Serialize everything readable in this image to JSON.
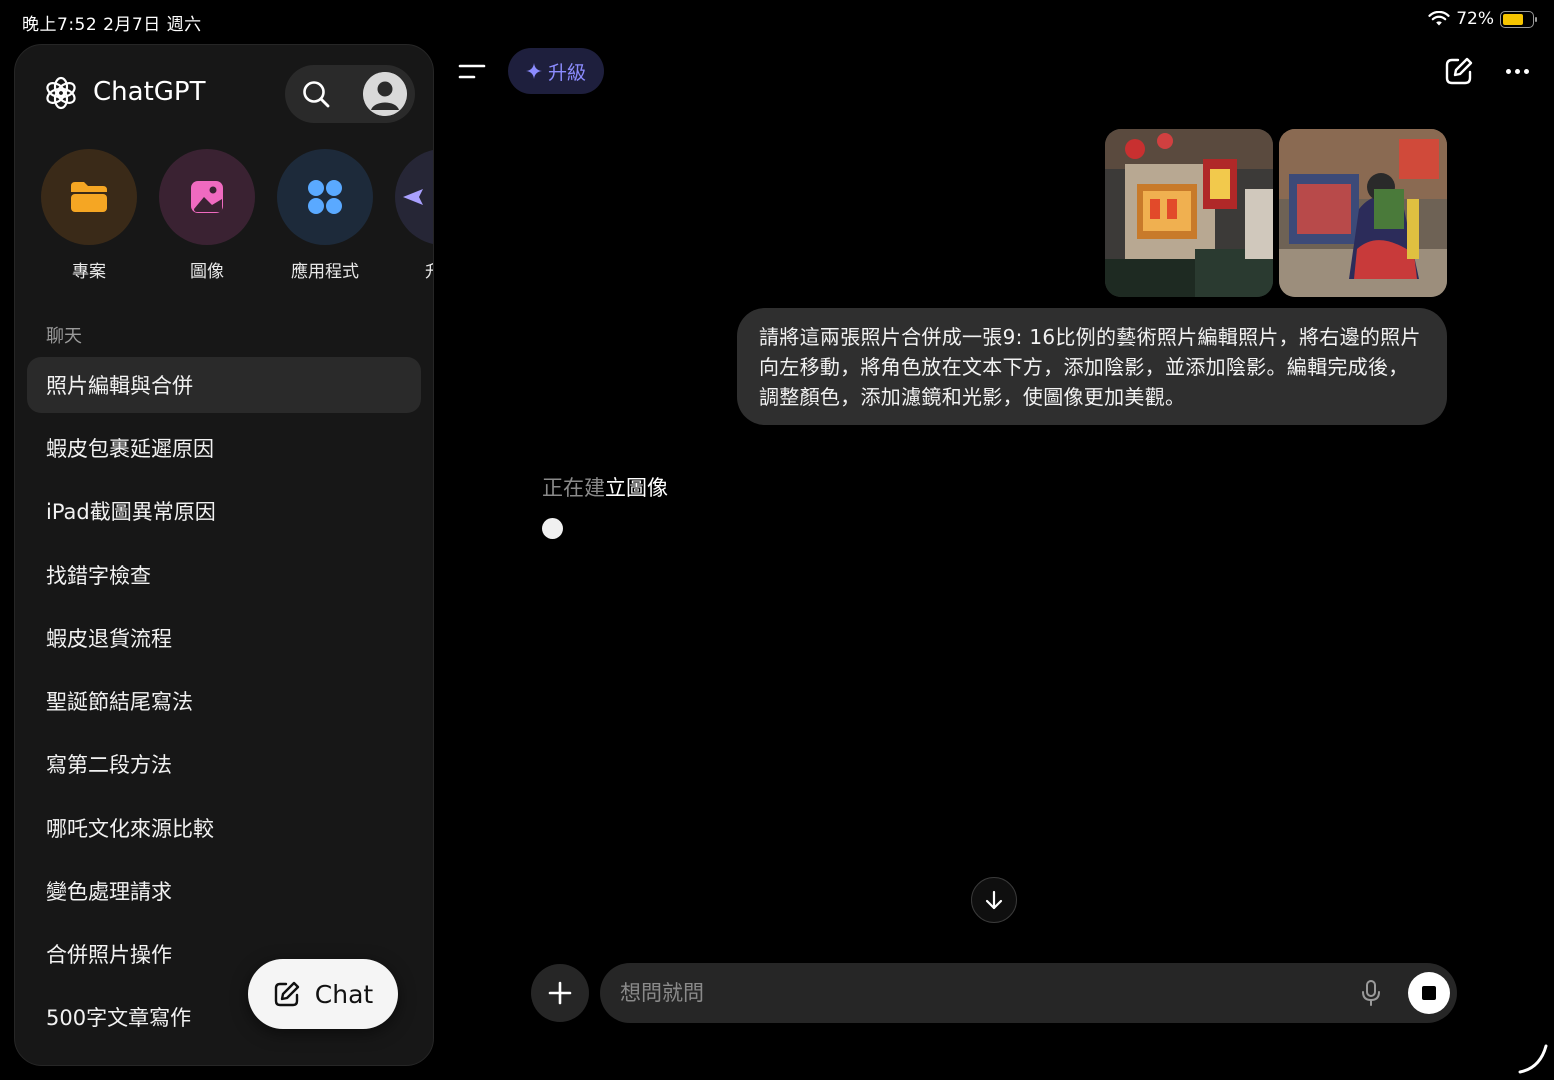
{
  "status_bar": {
    "time": "晚上7:52  2月7日 週六",
    "battery": "72%",
    "battery_level": 0.72
  },
  "sidebar": {
    "brand": "ChatGPT",
    "quick_actions": [
      {
        "label": "專案",
        "icon": "folder-icon",
        "color": "#f5a623",
        "bg": "#3a2a18"
      },
      {
        "label": "圖像",
        "icon": "image-icon",
        "color": "#f06ac0",
        "bg": "#3a2232"
      },
      {
        "label": "應用程式",
        "icon": "apps-icon",
        "color": "#5aa9ff",
        "bg": "#1d2a3a"
      },
      {
        "label": "升",
        "icon": "upgrade-icon",
        "color": "#a9a0ff",
        "bg": "#262636"
      }
    ],
    "section_title": "聊天",
    "chats": [
      "照片編輯與合併",
      "蝦皮包裹延遲原因",
      "iPad截圖異常原因",
      "找錯字檢查",
      "蝦皮退貨流程",
      "聖誕節結尾寫法",
      "寫第二段方法",
      "哪吒文化來源比較",
      "變色處理請求",
      "合併照片操作",
      "500字文章寫作"
    ],
    "active_index": 0,
    "new_chat_label": "Chat"
  },
  "main": {
    "upgrade_label": "升級",
    "user_message": "請將這兩張照片合併成一張9: 16比例的藝術照片編輯照片，將右邊的照片向左移動，將角色放在文本下方，添加陰影，並添加陰影。編輯完成後，調整顏色，添加濾鏡和光影，使圖像更加美觀。",
    "status_dim": "正在建",
    "status_bright": "立圖像",
    "composer_placeholder": "想問就問"
  }
}
